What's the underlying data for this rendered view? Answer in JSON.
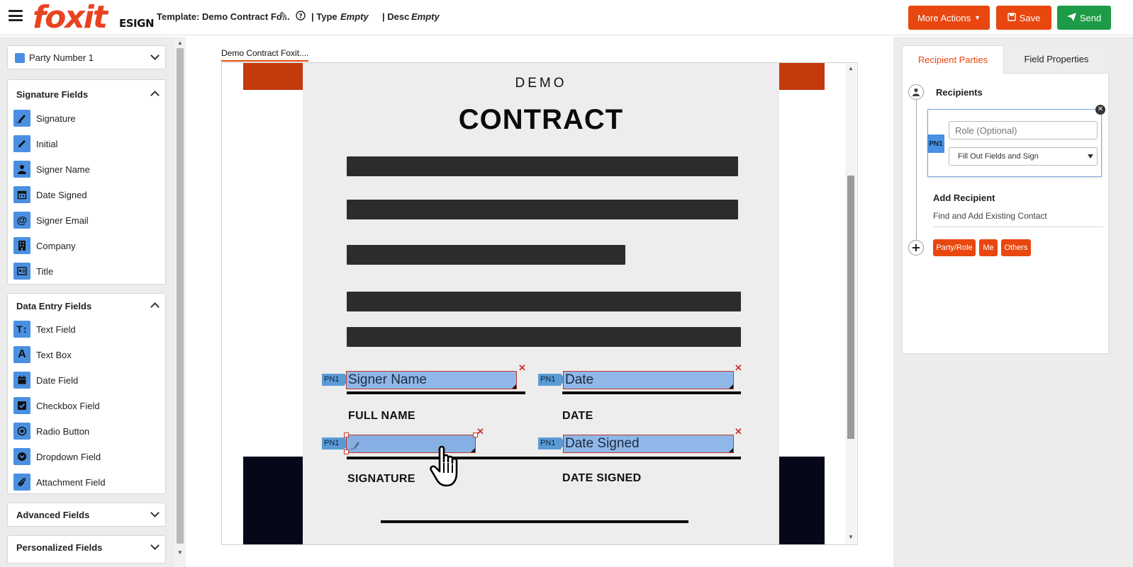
{
  "header": {
    "logo": "foxit",
    "logo_sub": "ESIGN",
    "template_label": "Template: Demo Contract Fo...",
    "type_label": "| Type",
    "type_value": "Empty",
    "desc_label": "| Desc",
    "desc_value": "Empty",
    "more_actions": "More Actions",
    "save": "Save",
    "send": "Send"
  },
  "left_panel": {
    "party_selector": "Party Number 1",
    "signature_section": {
      "title": "Signature Fields",
      "items": [
        {
          "label": "Signature",
          "icon": "signature-icon"
        },
        {
          "label": "Initial",
          "icon": "pencil-icon"
        },
        {
          "label": "Signer Name",
          "icon": "person-icon"
        },
        {
          "label": "Date Signed",
          "icon": "calendar-icon"
        },
        {
          "label": "Signer Email",
          "icon": "at-icon"
        },
        {
          "label": "Company",
          "icon": "building-icon"
        },
        {
          "label": "Title",
          "icon": "id-card-icon"
        }
      ]
    },
    "data_entry_section": {
      "title": "Data Entry Fields",
      "items": [
        {
          "label": "Text Field",
          "icon": "text-field-icon"
        },
        {
          "label": "Text Box",
          "icon": "text-box-icon"
        },
        {
          "label": "Date Field",
          "icon": "calendar-icon"
        },
        {
          "label": "Checkbox Field",
          "icon": "checkbox-icon"
        },
        {
          "label": "Radio Button",
          "icon": "radio-icon"
        },
        {
          "label": "Dropdown Field",
          "icon": "dropdown-icon"
        },
        {
          "label": "Attachment Field",
          "icon": "paperclip-icon"
        }
      ]
    },
    "advanced_section": {
      "title": "Advanced Fields"
    },
    "personalized_section": {
      "title": "Personalized Fields"
    }
  },
  "document": {
    "tab_label": "Demo Contract Foxit....",
    "heading_small": "DEMO",
    "heading_large": "CONTRACT",
    "labels": {
      "full_name": "FULL NAME",
      "date": "DATE",
      "signature": "SIGNATURE",
      "date_signed": "DATE SIGNED"
    },
    "fields": {
      "signer_name": {
        "tag": "PN1",
        "text": "Signer Name"
      },
      "date": {
        "tag": "PN1",
        "text": "Date"
      },
      "signature": {
        "tag": "PN1",
        "text": ""
      },
      "date_signed": {
        "tag": "PN1",
        "text": "Date Signed"
      }
    }
  },
  "right_panel": {
    "tabs": [
      "Recipient Parties",
      "Field Properties"
    ],
    "active_tab": "Recipient Parties",
    "recipients_title": "Recipients",
    "recipient": {
      "badge": "PN1",
      "role_placeholder": "Role (Optional)",
      "action_value": "Fill Out Fields and Sign"
    },
    "add_recipient_title": "Add Recipient",
    "find_contact": "Find and Add Existing Contact",
    "add_buttons": [
      "Party/Role",
      "Me",
      "Others"
    ]
  },
  "colors": {
    "brand_orange": "#e8470f",
    "send_green": "#1e9b46",
    "field_blue": "#8fb7e8",
    "party_blue": "#4a90e2"
  }
}
